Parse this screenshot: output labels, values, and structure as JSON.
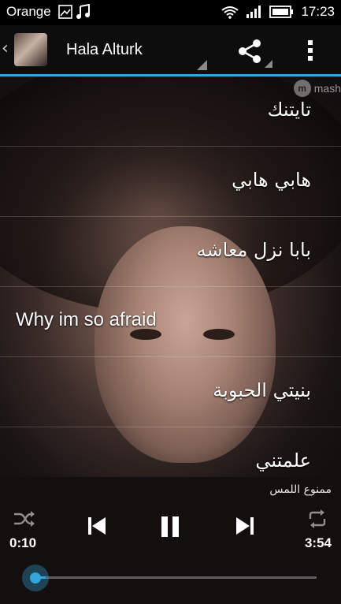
{
  "status": {
    "carrier": "Orange",
    "time": "17:23"
  },
  "topbar": {
    "title": "Hala Alturk"
  },
  "watermark": {
    "text": "mash"
  },
  "songs": [
    {
      "title": "تايتنك",
      "dir": "rtl"
    },
    {
      "title": "هابي هابي",
      "dir": "rtl"
    },
    {
      "title": "بابا نزل معاشه",
      "dir": "rtl"
    },
    {
      "title": "Why im so afraid",
      "dir": "ltr"
    },
    {
      "title": "بنيتي الحبوبة",
      "dir": "rtl"
    },
    {
      "title": "علمتني",
      "dir": "rtl"
    }
  ],
  "player": {
    "now_playing": "ممنوع اللمس",
    "current_time": "0:10",
    "duration": "3:54",
    "progress": 0.04
  },
  "colors": {
    "accent": "#33a6dc"
  }
}
